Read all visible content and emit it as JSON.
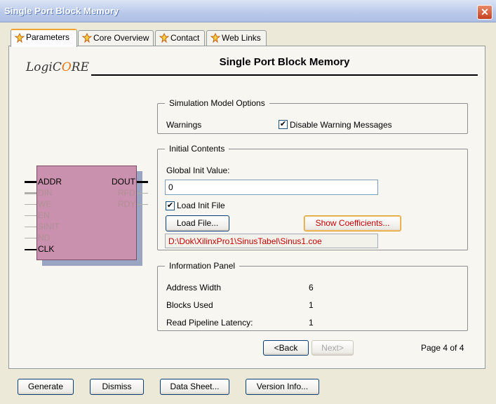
{
  "window": {
    "title": "Single Port Block Memory",
    "close_glyph": "✕"
  },
  "tabs": [
    {
      "label": "Parameters",
      "active": true
    },
    {
      "label": "Core Overview",
      "active": false
    },
    {
      "label": "Contact",
      "active": false
    },
    {
      "label": "Web Links",
      "active": false
    }
  ],
  "logo": {
    "part1": "LogiC",
    "part2": "RE"
  },
  "page_title": "Single Port Block Memory",
  "symbol": {
    "inputs": [
      "ADDR",
      "DIN",
      "WE",
      "EN",
      "SINIT",
      "ND",
      "CLK"
    ],
    "outputs": [
      "DOUT",
      "RFD",
      "RDY"
    ]
  },
  "simulation": {
    "legend": "Simulation Model Options",
    "warnings_label": "Warnings",
    "disable_warning": {
      "label": "Disable Warning Messages",
      "checked": true
    }
  },
  "initial": {
    "legend": "Initial Contents",
    "global_init_label": "Global Init Value:",
    "global_init_value": "0",
    "load_init": {
      "label": "Load Init File",
      "checked": true
    },
    "load_file_btn": "Load File...",
    "show_coeff_btn": "Show Coefficients...",
    "file_path": "D:\\Dok\\XilinxPro1\\SinusTabel\\Sinus1.coe"
  },
  "info": {
    "legend": "Information Panel",
    "rows": [
      {
        "label": "Address Width",
        "value": "6"
      },
      {
        "label": "Blocks Used",
        "value": "1"
      },
      {
        "label": "Read Pipeline Latency:",
        "value": "1"
      }
    ]
  },
  "nav": {
    "back": "<Back",
    "next": "Next>",
    "page": "Page 4 of 4"
  },
  "bottom": [
    "Generate",
    "Dismiss",
    "Data Sheet...",
    "Version Info..."
  ],
  "colors": {
    "accent": "#f0a533",
    "path": "#c00000",
    "block": "#c991ad"
  },
  "check_glyph": "✔"
}
